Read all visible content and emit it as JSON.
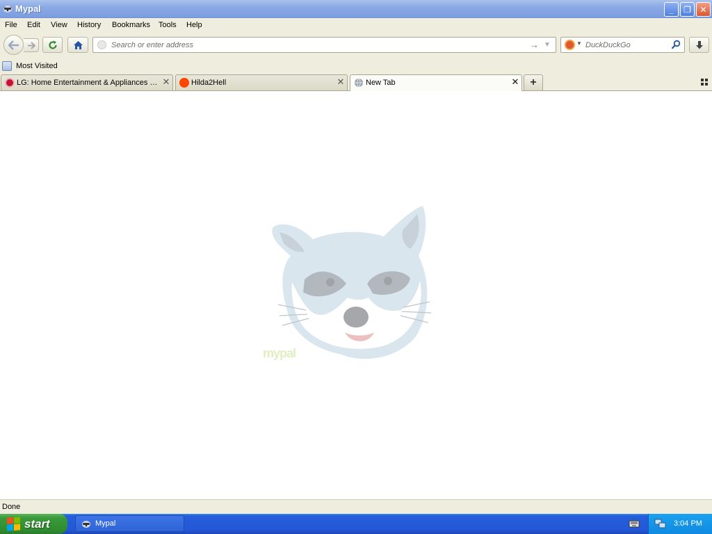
{
  "window": {
    "title": "Mypal",
    "buttons": {
      "minimize": "_",
      "maximize": "❐",
      "close": "✕"
    }
  },
  "menu": {
    "items": [
      "File",
      "Edit",
      "View",
      "History",
      "Bookmarks",
      "Tools",
      "Help"
    ]
  },
  "navbar": {
    "url_placeholder": "Search or enter address",
    "url_value": "",
    "search_placeholder": "DuckDuckGo",
    "search_engine": "duckduckgo-icon"
  },
  "bookmarks": {
    "items": [
      {
        "label": "Most Visited",
        "icon": "bookmark-folder-icon"
      }
    ]
  },
  "tabs": [
    {
      "label": "LG: Home Entertainment & Appliances | L...",
      "icon": "lg-favicon-icon",
      "color": "#c4122f",
      "active": false
    },
    {
      "label": "Hilda2Hell",
      "icon": "reddit-favicon-icon",
      "color": "#ff4500",
      "active": false
    },
    {
      "label": "New Tab",
      "icon": "globe-favicon-icon",
      "color": "#888888",
      "active": true
    }
  ],
  "tab_controls": {
    "close_glyph": "✕",
    "new_tab_glyph": "+"
  },
  "content": {
    "logo_text": "mypal"
  },
  "status": {
    "text": "Done"
  },
  "taskbar": {
    "start_label": "start",
    "task_label": "Mypal",
    "clock": "3:04 PM"
  },
  "colors": {
    "chrome_bg": "#eeedde",
    "titlebar": "#8aa9e4",
    "taskbar": "#245edb",
    "start": "#3a9a3a"
  }
}
